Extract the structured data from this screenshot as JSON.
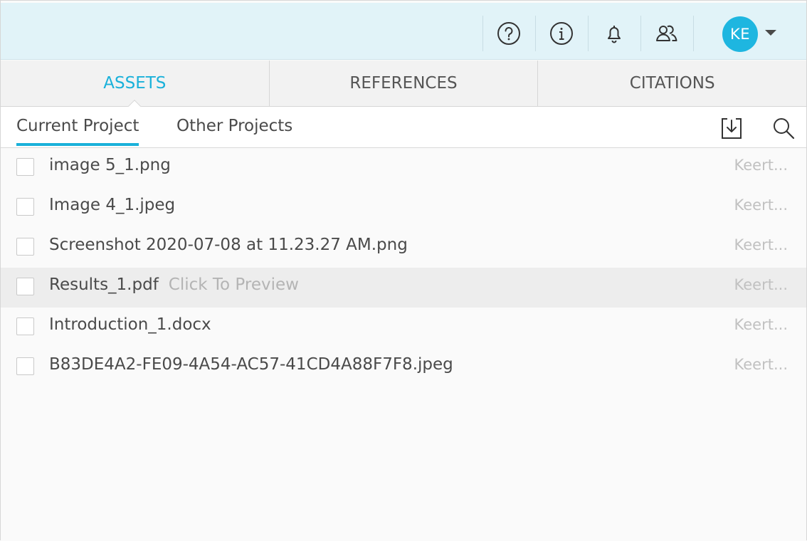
{
  "header": {
    "icons": [
      {
        "name": "help-icon"
      },
      {
        "name": "info-icon"
      },
      {
        "name": "notification-icon"
      },
      {
        "name": "collaborators-icon"
      }
    ],
    "avatar_initials": "KE",
    "accent_color": "#1ab1da"
  },
  "main_tabs": [
    {
      "label": "ASSETS",
      "active": true
    },
    {
      "label": "REFERENCES",
      "active": false
    },
    {
      "label": "CITATIONS",
      "active": false
    }
  ],
  "sub_tabs": [
    {
      "label": "Current Project",
      "active": true
    },
    {
      "label": "Other Projects",
      "active": false
    }
  ],
  "toolbar": {
    "icons": [
      "download-icon",
      "search-icon"
    ]
  },
  "files": [
    {
      "name": "image 5_1.png",
      "owner": "Keert...",
      "checked": false
    },
    {
      "name": "Image 4_1.jpeg",
      "owner": "Keert...",
      "checked": false
    },
    {
      "name": "Screenshot 2020-07-08 at 11.23.27 AM.png",
      "owner": "Keert...",
      "checked": false
    },
    {
      "name": "Results_1.pdf",
      "owner": "Keert...",
      "checked": false,
      "hover_text": "Click To Preview"
    },
    {
      "name": "Introduction_1.docx",
      "owner": "Keert...",
      "checked": false
    },
    {
      "name": "B83DE4A2-FE09-4A54-AC57-41CD4A88F7F8.jpeg",
      "owner": "Keert...",
      "checked": false
    }
  ]
}
